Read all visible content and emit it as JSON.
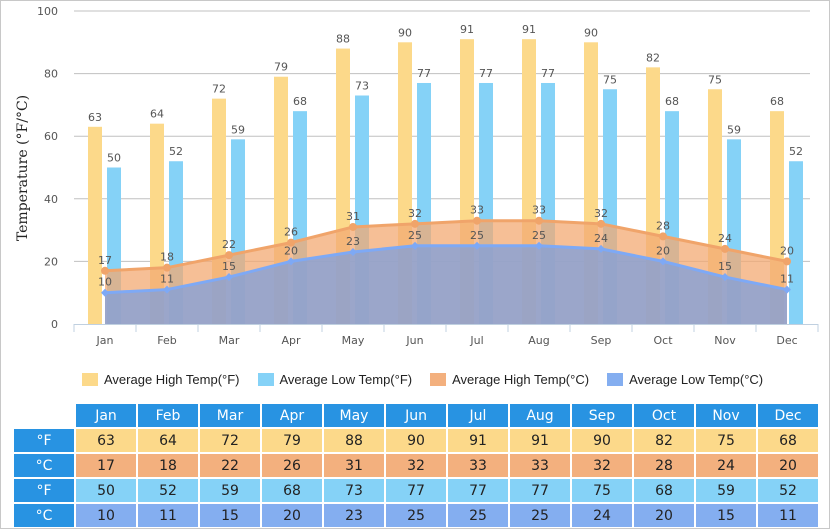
{
  "chart_data": {
    "type": "bar",
    "title": "",
    "xlabel": "",
    "ylabel": "Temperature (°F/°C)",
    "ylim": [
      0,
      100
    ],
    "yticks": [
      0,
      20,
      40,
      60,
      80,
      100
    ],
    "grid": true,
    "legend_position": "bottom",
    "categories": [
      "Jan",
      "Feb",
      "Mar",
      "Apr",
      "May",
      "Jun",
      "Jul",
      "Aug",
      "Sep",
      "Oct",
      "Nov",
      "Dec"
    ],
    "series": [
      {
        "name": "Average High Temp(°F)",
        "type": "bar",
        "color": "#fcd98a",
        "values": [
          63,
          64,
          72,
          79,
          88,
          90,
          91,
          91,
          90,
          82,
          75,
          68
        ]
      },
      {
        "name": "Average Low Temp(°F)",
        "type": "bar",
        "color": "#85d2f7",
        "values": [
          50,
          52,
          59,
          68,
          73,
          77,
          77,
          77,
          75,
          68,
          59,
          52
        ]
      },
      {
        "name": "Average High Temp(°C)",
        "type": "area",
        "color": "#f3b07e",
        "values": [
          17,
          18,
          22,
          26,
          31,
          32,
          33,
          33,
          32,
          28,
          24,
          20
        ]
      },
      {
        "name": "Average Low Temp(°C)",
        "type": "area",
        "color": "#84aef0",
        "values": [
          10,
          11,
          15,
          20,
          23,
          25,
          25,
          25,
          24,
          20,
          15,
          11
        ]
      }
    ]
  },
  "table": {
    "months": [
      "Jan",
      "Feb",
      "Mar",
      "Apr",
      "May",
      "Jun",
      "Jul",
      "Aug",
      "Sep",
      "Oct",
      "Nov",
      "Dec"
    ],
    "rows": [
      {
        "unit": "°F",
        "kind": "hf",
        "values": [
          63,
          64,
          72,
          79,
          88,
          90,
          91,
          91,
          90,
          82,
          75,
          68
        ]
      },
      {
        "unit": "°C",
        "kind": "hc",
        "values": [
          17,
          18,
          22,
          26,
          31,
          32,
          33,
          33,
          32,
          28,
          24,
          20
        ]
      },
      {
        "unit": "°F",
        "kind": "lf",
        "values": [
          50,
          52,
          59,
          68,
          73,
          77,
          77,
          77,
          75,
          68,
          59,
          52
        ]
      },
      {
        "unit": "°C",
        "kind": "lc",
        "values": [
          10,
          11,
          15,
          20,
          23,
          25,
          25,
          25,
          24,
          20,
          15,
          11
        ]
      }
    ]
  }
}
